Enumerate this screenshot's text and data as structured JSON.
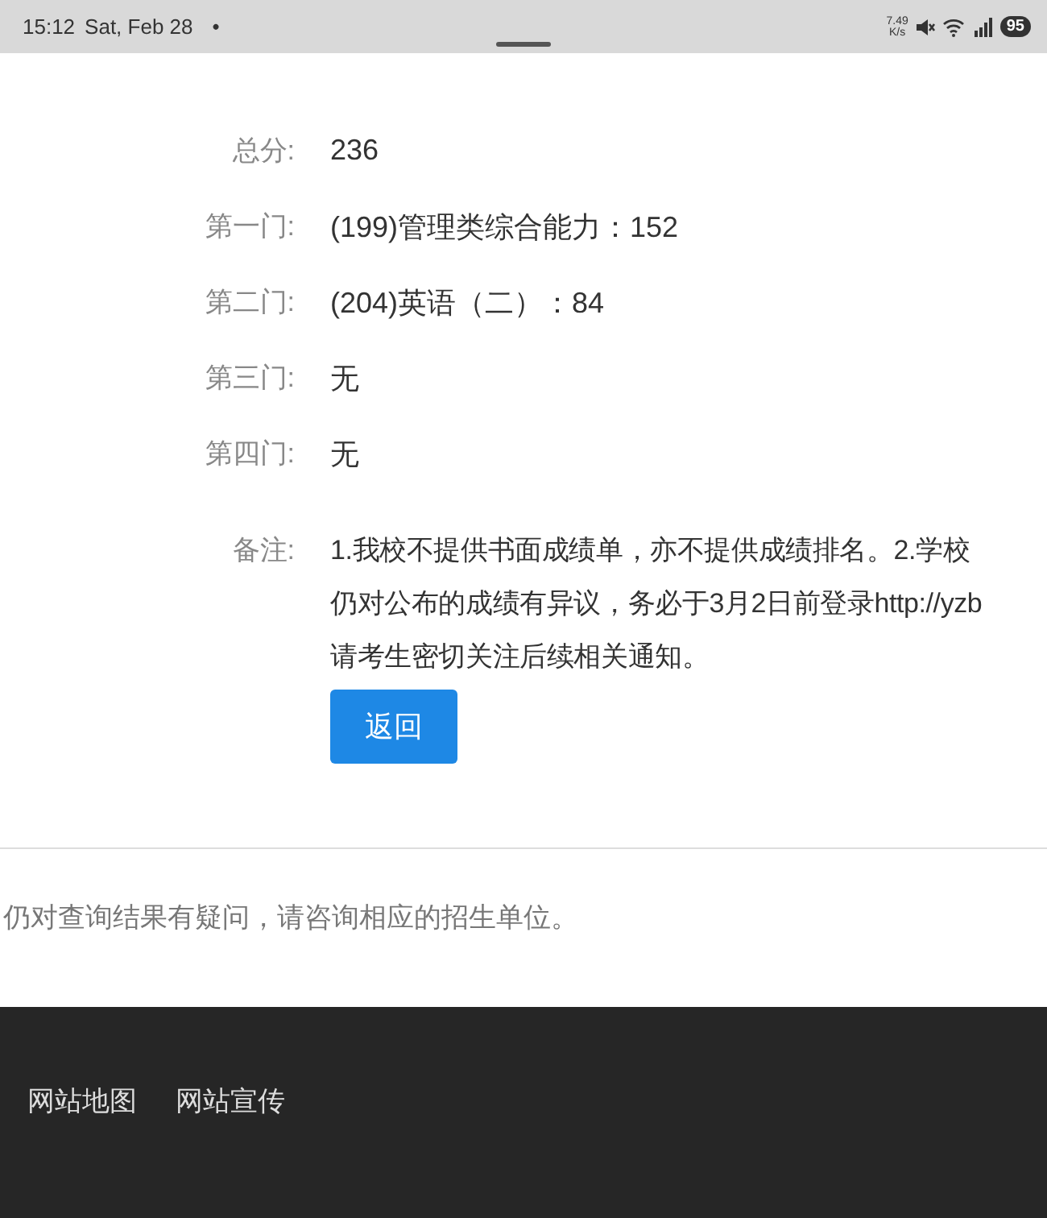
{
  "status_bar": {
    "time": "15:12",
    "date": "Sat, Feb 28",
    "dot": "•",
    "net_speed": [
      "7.49",
      "K/s"
    ],
    "battery": "95"
  },
  "scores": [
    {
      "label": "总分:",
      "value": "236"
    },
    {
      "label": "第一门:",
      "value": "(199)管理类综合能力：152"
    },
    {
      "label": "第二门:",
      "value": "(204)英语（二）：84"
    },
    {
      "label": "第三门:",
      "value": "无"
    },
    {
      "label": "第四门:",
      "value": "无"
    }
  ],
  "remark": {
    "label": "备注:",
    "lines": [
      "1.我校不提供书面成绩单，亦不提供成绩排名。2.学校",
      "仍对公布的成绩有异议，务必于3月2日前登录http://yzb",
      "请考生密切关注后续相关通知。"
    ]
  },
  "back_button": "返回",
  "notice": "仍对查询结果有疑问，请咨询相应的招生单位。",
  "footer": {
    "links": [
      "网站地图",
      "网站宣传"
    ]
  }
}
